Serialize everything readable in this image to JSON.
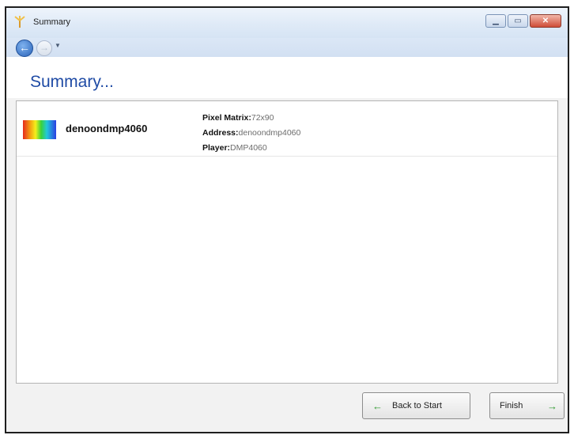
{
  "window": {
    "title": "Summary"
  },
  "page": {
    "heading": "Summary..."
  },
  "device": {
    "name": "denoondmp4060",
    "details": [
      {
        "label": "Pixel Matrix:",
        "value": "72x90"
      },
      {
        "label": "Address:",
        "value": "denoondmp4060"
      },
      {
        "label": "Player:",
        "value": "DMP4060"
      }
    ]
  },
  "buttons": {
    "back_to_start": "Back to Start",
    "finish": "Finish"
  }
}
